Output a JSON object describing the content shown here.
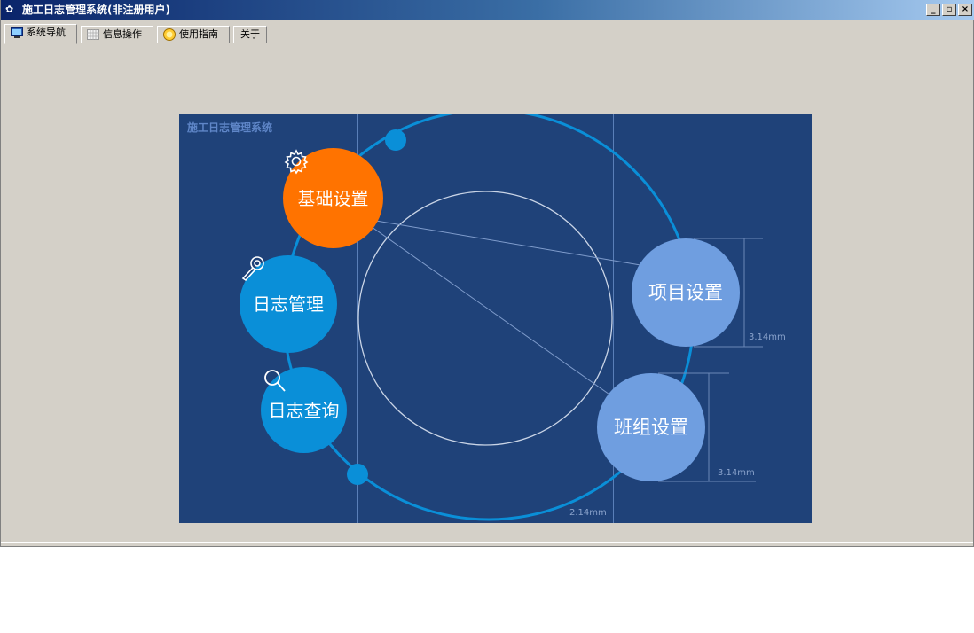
{
  "window": {
    "title": "施工日志管理系统(非注册用户)",
    "controls": [
      "_",
      "▫",
      "×"
    ]
  },
  "tabs": [
    {
      "label": "系统导航",
      "icon": "monitor-icon",
      "active": true
    },
    {
      "label": "信息操作",
      "icon": "grid-icon",
      "active": false
    },
    {
      "label": "使用指南",
      "icon": "help-icon",
      "active": false
    },
    {
      "label": "关于",
      "icon": "",
      "active": false
    }
  ],
  "panel": {
    "title": "施工日志管理系统",
    "buttons": {
      "base": {
        "label": "基础设置",
        "icon": "gear-icon",
        "color": "#ff7300"
      },
      "log_manage": {
        "label": "日志管理",
        "icon": "key-icon",
        "color": "#0a8fd8"
      },
      "log_query": {
        "label": "日志查询",
        "icon": "search-icon",
        "color": "#0a8fd8"
      },
      "project": {
        "label": "项目设置",
        "color": "#6f9ee0"
      },
      "team": {
        "label": "班组设置",
        "color": "#6f9ee0"
      }
    },
    "dims": {
      "project_dim": "3.14mm",
      "team_dim": "3.14mm",
      "bottom_dim": "2.14mm"
    }
  },
  "colors": {
    "panel_bg": "#1f4279",
    "ring": "#0a8fd8",
    "window_bg": "#d4d0c8"
  }
}
